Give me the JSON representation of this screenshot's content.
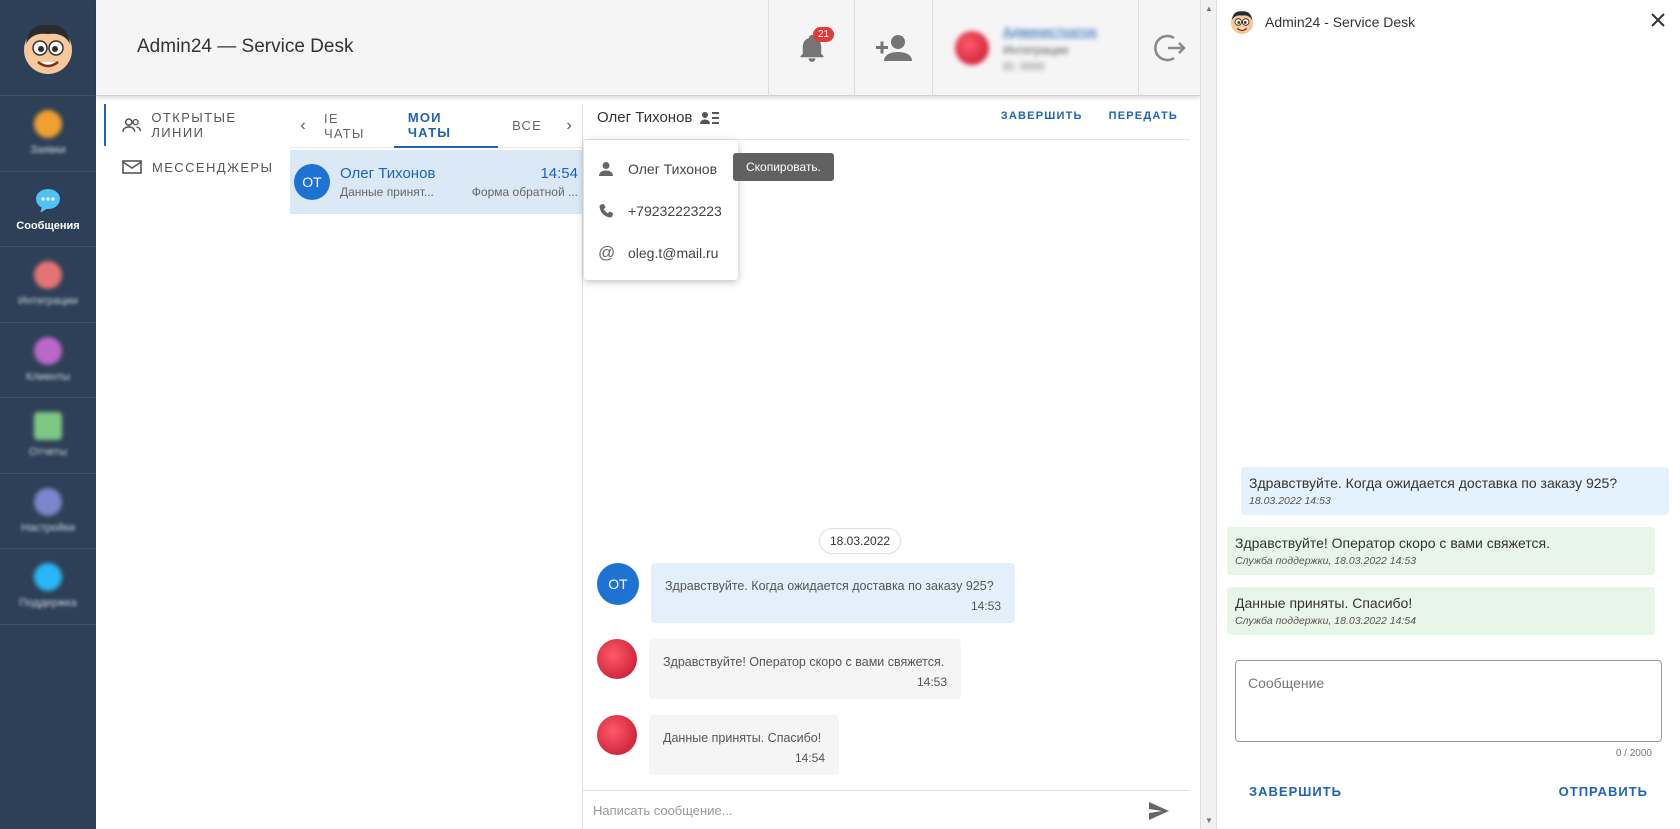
{
  "header": {
    "app_title": "Admin24 — Service Desk",
    "notifications_count": "21",
    "user_name": "Администратор",
    "user_role": "Интеграции",
    "user_id": "ID: 0000"
  },
  "sidebar": {
    "items": [
      {
        "label": "Заявки",
        "icon": "megaphone-icon",
        "color": "#f0a030"
      },
      {
        "label": "Сообщения",
        "icon": "chat-bubbles-icon",
        "color": "#4fc3f7"
      },
      {
        "label": "Интеграции",
        "icon": "puzzle-icon",
        "color": "#e57373"
      },
      {
        "label": "Клиенты",
        "icon": "people-icon",
        "color": "#ba68c8"
      },
      {
        "label": "Отчеты",
        "icon": "report-icon",
        "color": "#81c784"
      },
      {
        "label": "Настройки",
        "icon": "gear-icon",
        "color": "#7986cb"
      },
      {
        "label": "Поддержка",
        "icon": "support-icon",
        "color": "#29b6f6"
      }
    ]
  },
  "lines_nav": {
    "items": [
      {
        "label": "Открытые линии",
        "icon": "people-outline-icon"
      },
      {
        "label": "Мессенджеры",
        "icon": "mail-icon"
      }
    ]
  },
  "tabs": {
    "items": [
      "IE ЧАТЫ",
      "МОИ ЧАТЫ",
      "ВСЕ"
    ],
    "active": "МОИ ЧАТЫ"
  },
  "chat_list": [
    {
      "initials": "ОТ",
      "name": "Олег Тихонов",
      "time": "14:54",
      "preview": "Данные принят...",
      "source": "Форма обратной ..."
    }
  ],
  "conversation": {
    "contact_name": "Олег Тихонов",
    "finish_label": "ЗАВЕРШИТЬ",
    "transfer_label": "ПЕРЕДАТЬ",
    "date": "18.03.2022",
    "messages": [
      {
        "text": "Здравствуйте. Когда ожидается доставка по заказу 925?",
        "time": "14:53",
        "from": "client",
        "initials": "ОТ"
      },
      {
        "text": "Здравствуйте! Оператор скоро с вами свяжется.",
        "time": "14:53",
        "from": "operator"
      },
      {
        "text": "Данные приняты. Спасибо!",
        "time": "14:54",
        "from": "operator"
      }
    ],
    "input_placeholder": "Написать сообщение..."
  },
  "contact_popup": {
    "name": "Олег Тихонов",
    "phone": "+79232223223",
    "email": "oleg.t@mail.ru",
    "tooltip": "Скопировать."
  },
  "widget": {
    "title": "Admin24 - Service Desk",
    "messages": [
      {
        "text": "Здравствуйте. Когда ожидается доставка по заказу 925?",
        "sub": "18.03.2022 14:53",
        "from": "client"
      },
      {
        "text": "Здравствуйте! Оператор скоро с вами свяжется.",
        "sub": "Служба поддержки, 18.03.2022 14:53",
        "from": "operator"
      },
      {
        "text": "Данные приняты. Спасибо!",
        "sub": "Служба поддержки, 18.03.2022 14:54",
        "from": "operator"
      }
    ],
    "input_placeholder": "Сообщение",
    "counter": "0 / 2000",
    "finish_label": "ЗАВЕРШИТЬ",
    "send_label": "ОТПРАВИТЬ"
  },
  "colors": {
    "accent": "#1e63b5",
    "sidebar_bg": "#2e4057",
    "badge": "#e53935"
  }
}
